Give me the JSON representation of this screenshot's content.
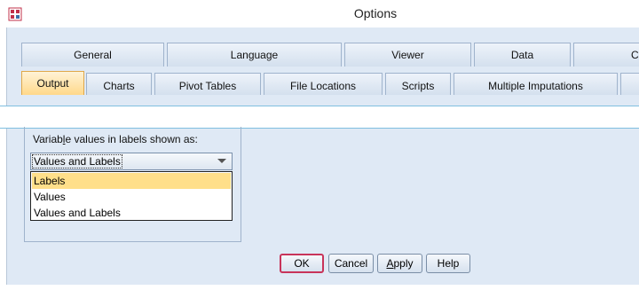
{
  "window": {
    "title": "Options"
  },
  "tabs_row1": [
    "General",
    "Language",
    "Viewer",
    "Data",
    "C"
  ],
  "tabs_row2": [
    "Output",
    "Charts",
    "Pivot Tables",
    "File Locations",
    "Scripts",
    "Multiple Imputations"
  ],
  "active_tab": "Output",
  "group": {
    "label_before": "Variable values in labels shown as:",
    "label_pre": "Variab",
    "label_mnemonic": "l",
    "label_post": "e values in labels shown as:"
  },
  "select": {
    "value": "Values and Labels",
    "options": [
      "Labels",
      "Values",
      "Values and Labels"
    ],
    "highlighted": "Labels"
  },
  "buttons": {
    "ok": "OK",
    "cancel": "Cancel",
    "apply_mnemonic": "A",
    "apply_rest": "pply",
    "help": "Help"
  },
  "colors": {
    "active_tab": "#ffd88a",
    "highlight": "#ffdf8a",
    "default_button_border": "#c8345a"
  }
}
